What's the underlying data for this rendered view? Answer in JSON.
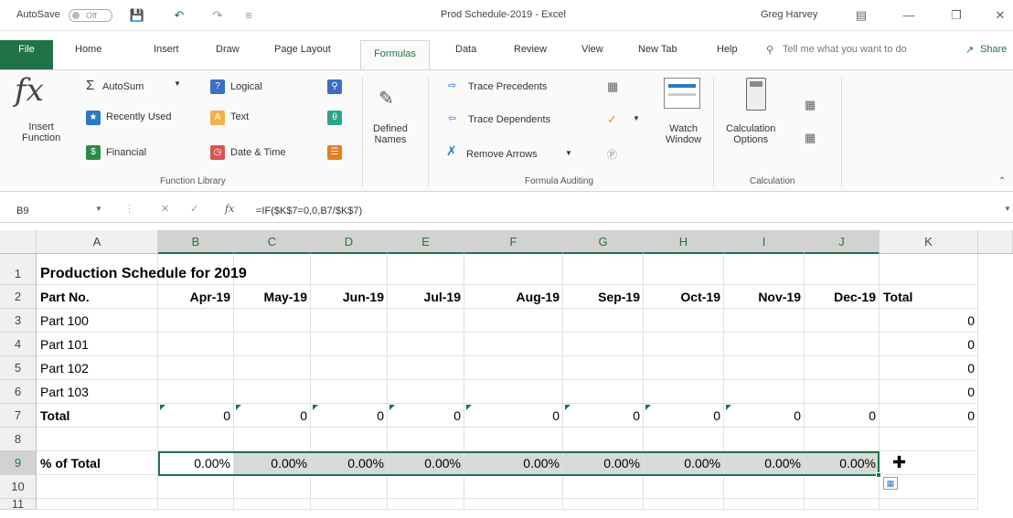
{
  "titlebar": {
    "autosave": "AutoSave",
    "autosave_state": "Off",
    "doc_title": "Prod Schedule-2019 - Excel",
    "user": "Greg Harvey"
  },
  "tabs": [
    "File",
    "Home",
    "Insert",
    "Draw",
    "Page Layout",
    "Formulas",
    "Data",
    "Review",
    "View",
    "New Tab",
    "Help"
  ],
  "tell_me": "Tell me what you want to do",
  "share": "Share",
  "ribbon": {
    "insert_function": [
      "Insert",
      "Function"
    ],
    "autosum": "AutoSum",
    "recently_used": "Recently Used",
    "financial": "Financial",
    "logical": "Logical",
    "text": "Text",
    "date_time": "Date & Time",
    "function_library": "Function Library",
    "defined_names": [
      "Defined",
      "Names"
    ],
    "trace_precedents": "Trace Precedents",
    "trace_dependents": "Trace Dependents",
    "remove_arrows": "Remove Arrows",
    "formula_auditing": "Formula Auditing",
    "watch_window": [
      "Watch",
      "Window"
    ],
    "calc_options": [
      "Calculation",
      "Options"
    ],
    "calculation": "Calculation"
  },
  "formula_bar": {
    "name_box": "B9",
    "formula": "=IF($K$7=0,0,B7/$K$7)"
  },
  "columns": [
    "A",
    "B",
    "C",
    "D",
    "E",
    "F",
    "G",
    "H",
    "I",
    "J",
    "K"
  ],
  "rows": [
    "1",
    "2",
    "3",
    "4",
    "5",
    "6",
    "7",
    "8",
    "9",
    "10",
    "11"
  ],
  "sheet": {
    "title": "Production Schedule for 2019",
    "header": [
      "Part No.",
      "Apr-19",
      "May-19",
      "Jun-19",
      "Jul-19",
      "Aug-19",
      "Sep-19",
      "Oct-19",
      "Nov-19",
      "Dec-19",
      "Total"
    ],
    "parts": [
      "Part 100",
      "Part 101",
      "Part 102",
      "Part 103"
    ],
    "part_totals": [
      "0",
      "0",
      "0",
      "0"
    ],
    "total_label": "Total",
    "totals": [
      "0",
      "0",
      "0",
      "0",
      "0",
      "0",
      "0",
      "0",
      "0",
      "0"
    ],
    "pct_label": "% of Total",
    "pcts": [
      "0.00%",
      "0.00%",
      "0.00%",
      "0.00%",
      "0.00%",
      "0.00%",
      "0.00%",
      "0.00%",
      "0.00%"
    ]
  }
}
